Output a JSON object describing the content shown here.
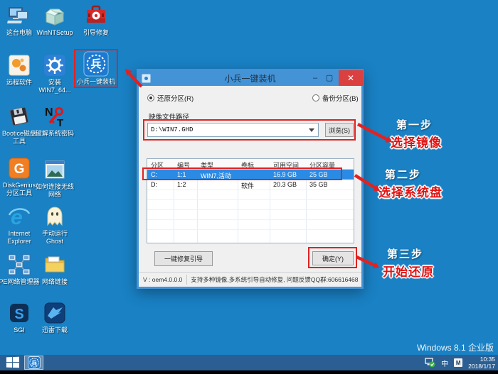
{
  "desktop": {
    "watermark": "Windows 8.1 企业版",
    "icons": [
      {
        "id": "this-pc",
        "lines": [
          "这台电脑"
        ]
      },
      {
        "id": "winntsetup",
        "lines": [
          "WinNTSetup"
        ]
      },
      {
        "id": "boot-repair",
        "lines": [
          "引导修复"
        ]
      },
      {
        "id": "remote-software",
        "lines": [
          "远程软件"
        ]
      },
      {
        "id": "install-win7",
        "lines": [
          "安装",
          "WIN7_64..."
        ]
      },
      {
        "id": "xiaobing",
        "lines": [
          "小兵一键装机"
        ]
      },
      {
        "id": "bootice",
        "lines": [
          "Bootice磁盘",
          "工具"
        ]
      },
      {
        "id": "crack-password",
        "lines": [
          "破解系统密码"
        ]
      },
      {
        "id": "diskgenius",
        "lines": [
          "DiskGenius",
          "分区工具"
        ]
      },
      {
        "id": "wireless-help",
        "lines": [
          "如何连接无线",
          "网络"
        ]
      },
      {
        "id": "ie",
        "lines": [
          "Internet",
          "Explorer"
        ]
      },
      {
        "id": "ghost",
        "lines": [
          "手动运行",
          "Ghost"
        ]
      },
      {
        "id": "pe-network",
        "lines": [
          "PE网络管理器"
        ]
      },
      {
        "id": "network-link",
        "lines": [
          "网络链接"
        ]
      },
      {
        "id": "sgi",
        "lines": [
          "SGI"
        ]
      },
      {
        "id": "thunder",
        "lines": [
          "迅雷下载"
        ]
      }
    ]
  },
  "dialog": {
    "title": "小兵一键装机",
    "radio_restore": "还原分区(R)",
    "radio_backup": "备份分区(B)",
    "image_path_label": "映像文件路径",
    "image_path_value": "D:\\WIN7.GHD",
    "browse_button": "浏览(S)",
    "table": {
      "headers": [
        "分区",
        "编号",
        "类型",
        "卷标",
        "可用空间",
        "分区容量"
      ],
      "rows": [
        {
          "cells": [
            "C:",
            "1:1",
            "WIN7,活动",
            "",
            "16.9 GB",
            "25 GB"
          ],
          "selected": true
        },
        {
          "cells": [
            "D:",
            "1:2",
            "",
            "软件",
            "20.3 GB",
            "35 GB"
          ],
          "selected": false
        }
      ]
    },
    "repair_button": "一键修复引导",
    "ok_button": "确定(Y)",
    "status_version": "V : oem4.0.0.0",
    "status_text": "支持多种镜像,多系统引导自动修复, 问题反馈QQ群:606616468"
  },
  "annotations": {
    "step1": {
      "title": "第一步",
      "subtitle": "选择镜像"
    },
    "step2": {
      "title": "第二步",
      "subtitle": "选择系统盘"
    },
    "step3": {
      "title": "第三步",
      "subtitle": "开始还原"
    }
  },
  "taskbar": {
    "tray": {
      "ime_cn": "中",
      "ime_mode": "M",
      "time": "10:35",
      "date": "2018/1/17"
    }
  },
  "colors": {
    "desktop_bg": "#1981c4",
    "taskbar_bg": "#2b5f93",
    "titlebar_blue": "#4493d6",
    "selection_blue": "#2b8be4",
    "annotation_red": "#e02222",
    "close_red": "#d9403f"
  }
}
